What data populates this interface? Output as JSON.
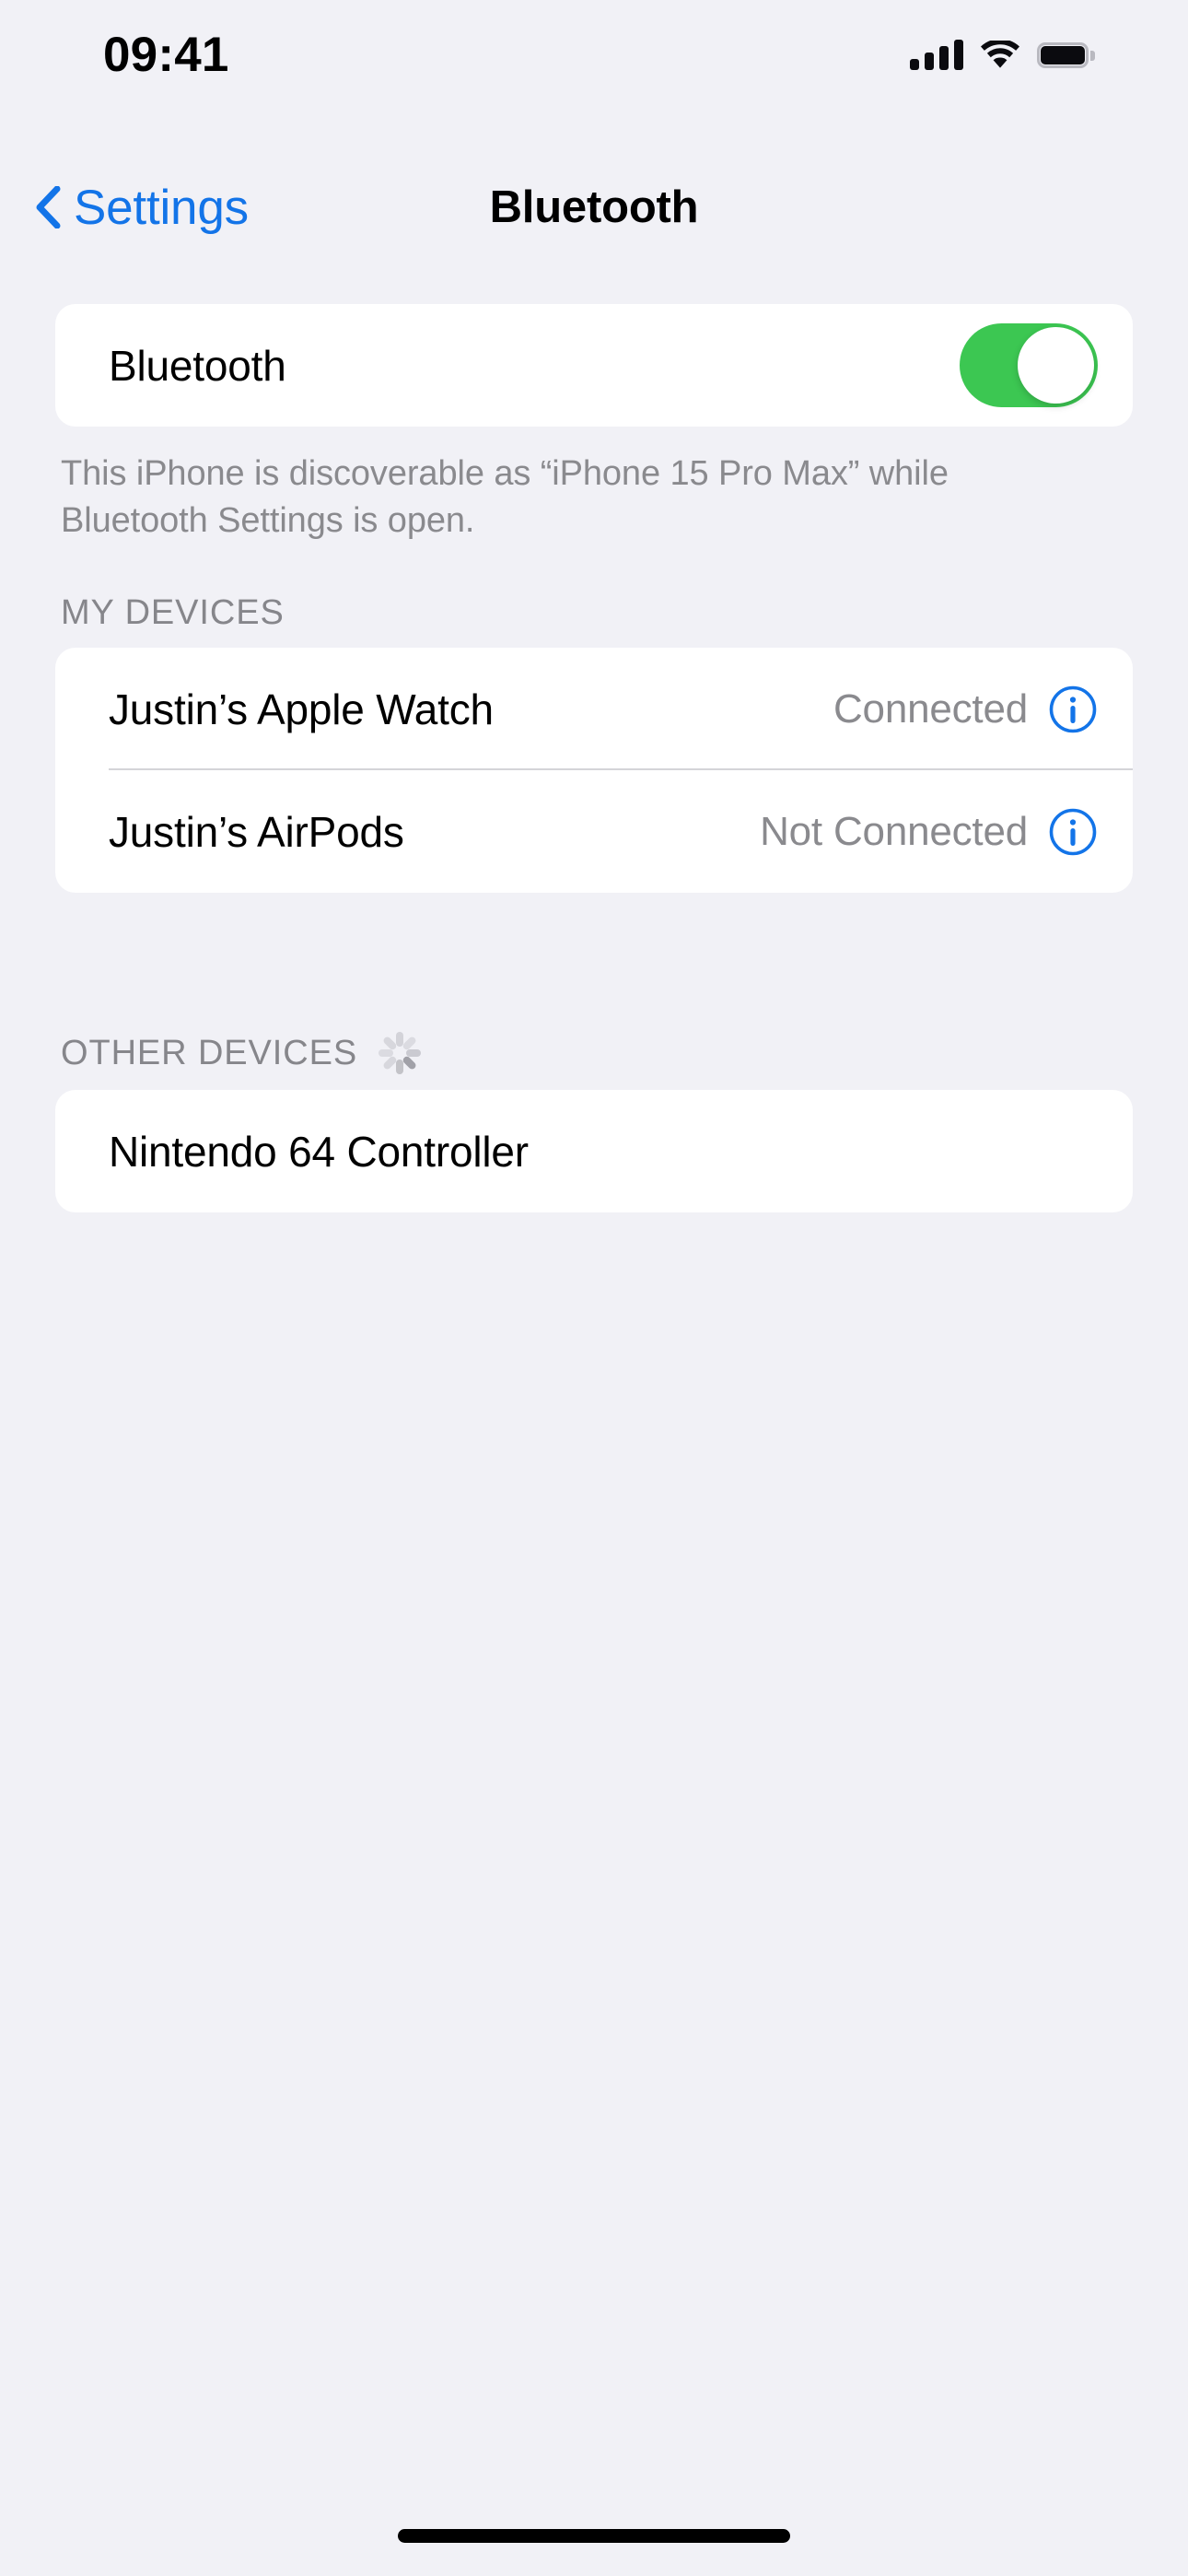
{
  "status_bar": {
    "time": "09:41",
    "cellular_icon": "cellular-signal-icon",
    "cellular_bars": 4,
    "wifi_icon": "wifi-icon",
    "battery_icon": "battery-icon",
    "battery_level": 100
  },
  "nav": {
    "back_icon": "chevron-left-icon",
    "back_label": "Settings",
    "title": "Bluetooth"
  },
  "bluetooth": {
    "label": "Bluetooth",
    "toggle_on": true,
    "toggle_color": "#3CC752",
    "note": "This iPhone is discoverable as “iPhone 15 Pro Max” while Bluetooth Settings is open."
  },
  "my_devices": {
    "header": "MY DEVICES",
    "rows": [
      {
        "name": "Justin’s Apple Watch",
        "status": "Connected",
        "info_icon": "info-circle-icon"
      },
      {
        "name": "Justin’s AirPods",
        "status": "Not Connected",
        "info_icon": "info-circle-icon"
      }
    ]
  },
  "other_devices": {
    "header": "OTHER DEVICES",
    "spinner_icon": "activity-spinner-icon",
    "rows": [
      {
        "name": "Nintendo 64 Controller",
        "status": "",
        "info_icon": ""
      }
    ]
  },
  "colors": {
    "accent_blue": "#1374E8",
    "toggle_green": "#3CC752",
    "background": "#F1F1F6",
    "card": "#FFFFFF",
    "secondary_text": "#8A8A8E",
    "header_text": "#86868B"
  },
  "home_indicator": "home-indicator"
}
